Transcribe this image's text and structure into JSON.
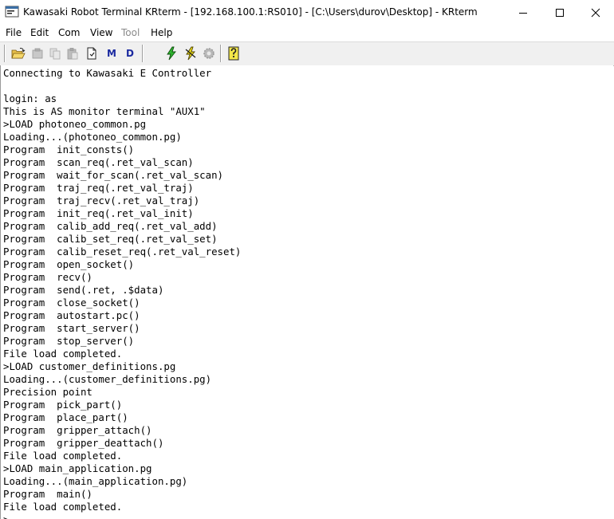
{
  "window": {
    "title": "Kawasaki Robot Terminal KRterm - [192.168.100.1:RS010] - [C:\\Users\\durov\\Desktop] - KRterm",
    "icon": "kawasaki-app-icon",
    "controls": {
      "minimize": "minimize-icon",
      "maximize": "maximize-icon",
      "close": "close-icon"
    }
  },
  "menu": {
    "file": "File",
    "edit": "Edit",
    "com": "Com",
    "view": "View",
    "tool": "Tool",
    "help": "Help"
  },
  "toolbar": {
    "buttons": [
      "open-folder-icon",
      "cut-icon",
      "copy-icon",
      "paste-icon",
      "new-document-icon",
      "M",
      "D",
      "connect-lightning-icon",
      "disconnect-lightning-icon",
      "settings-gear-icon",
      "help-icon"
    ],
    "m_label": "M",
    "d_label": "D"
  },
  "terminal": {
    "lines": [
      "Connecting to Kawasaki E Controller",
      "",
      "login: as",
      "This is AS monitor terminal \"AUX1\"",
      ">LOAD photoneo_common.pg",
      "Loading...(photoneo_common.pg)",
      "Program  init_consts()",
      "Program  scan_req(.ret_val_scan)",
      "Program  wait_for_scan(.ret_val_scan)",
      "Program  traj_req(.ret_val_traj)",
      "Program  traj_recv(.ret_val_traj)",
      "Program  init_req(.ret_val_init)",
      "Program  calib_add_req(.ret_val_add)",
      "Program  calib_set_req(.ret_val_set)",
      "Program  calib_reset_req(.ret_val_reset)",
      "Program  open_socket()",
      "Program  recv()",
      "Program  send(.ret, .$data)",
      "Program  close_socket()",
      "Program  autostart.pc()",
      "Program  start_server()",
      "Program  stop_server()",
      "File load completed.",
      ">LOAD customer_definitions.pg",
      "Loading...(customer_definitions.pg)",
      "Precision point",
      "Program  pick_part()",
      "Program  place_part()",
      "Program  gripper_attach()",
      "Program  gripper_deattach()",
      "File load completed.",
      ">LOAD main_application.pg",
      "Loading...(main_application.pg)",
      "Program  main()",
      "File load completed.",
      ">"
    ]
  }
}
